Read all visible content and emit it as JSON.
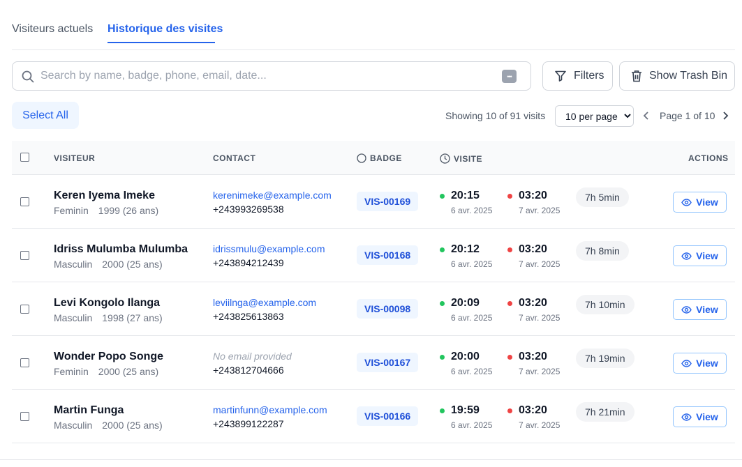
{
  "tabs": [
    {
      "label": "Visiteurs actuels",
      "active": false
    },
    {
      "label": "Historique des visites",
      "active": true
    }
  ],
  "search": {
    "placeholder": "Search by name, badge, phone, email, date...",
    "value": ""
  },
  "toolbar": {
    "filters_label": "Filters",
    "trash_label": "Show Trash Bin"
  },
  "select_all_label": "Select All",
  "pagination": {
    "showing_text": "Showing 10 of 91 visits",
    "per_page_selected": "10 per page",
    "page_label": "Page 1 of 10"
  },
  "table": {
    "headers": {
      "visitor": "VISITEUR",
      "contact": "CONTACT",
      "badge": "BADGE",
      "visit": "VISITE",
      "actions": "ACTIONS"
    },
    "view_label": "View",
    "rows": [
      {
        "name": "Keren Iyema Imeke",
        "gender": "Feminin",
        "birth": "1999 (26 ans)",
        "email": "kerenimeke@example.com",
        "phone": "+243993269538",
        "badge": "VIS-00169",
        "in_time": "20:15",
        "in_date": "6 avr. 2025",
        "out_time": "03:20",
        "out_date": "7 avr. 2025",
        "duration": "7h 5min"
      },
      {
        "name": "Idriss Mulumba Mulumba",
        "gender": "Masculin",
        "birth": "2000 (25 ans)",
        "email": "idrissmulu@example.com",
        "phone": "+243894212439",
        "badge": "VIS-00168",
        "in_time": "20:12",
        "in_date": "6 avr. 2025",
        "out_time": "03:20",
        "out_date": "7 avr. 2025",
        "duration": "7h 8min"
      },
      {
        "name": "Levi Kongolo Ilanga",
        "gender": "Masculin",
        "birth": "1998 (27 ans)",
        "email": "leviilnga@example.com",
        "phone": "+243825613863",
        "badge": "VIS-00098",
        "in_time": "20:09",
        "in_date": "6 avr. 2025",
        "out_time": "03:20",
        "out_date": "7 avr. 2025",
        "duration": "7h 10min"
      },
      {
        "name": "Wonder Popo Songe",
        "gender": "Feminin",
        "birth": "2000 (25 ans)",
        "email": "No email provided",
        "phone": "+243812704666",
        "badge": "VIS-00167",
        "in_time": "20:00",
        "in_date": "6 avr. 2025",
        "out_time": "03:20",
        "out_date": "7 avr. 2025",
        "duration": "7h 19min"
      },
      {
        "name": "Martin Funga",
        "gender": "Masculin",
        "birth": "2000 (25 ans)",
        "email": "martinfunn@example.com",
        "phone": "+243899122287",
        "badge": "VIS-00166",
        "in_time": "19:59",
        "in_date": "6 avr. 2025",
        "out_time": "03:20",
        "out_date": "7 avr. 2025",
        "duration": "7h 21min"
      }
    ]
  },
  "colors": {
    "accent": "#2563eb",
    "check_in": "#22c55e",
    "check_out": "#ef4444"
  },
  "icons": {
    "search": "search-icon",
    "filters": "filter-icon",
    "trash": "trash-icon",
    "badge": "circle-icon",
    "visit": "clock-icon",
    "view": "eye-icon"
  }
}
